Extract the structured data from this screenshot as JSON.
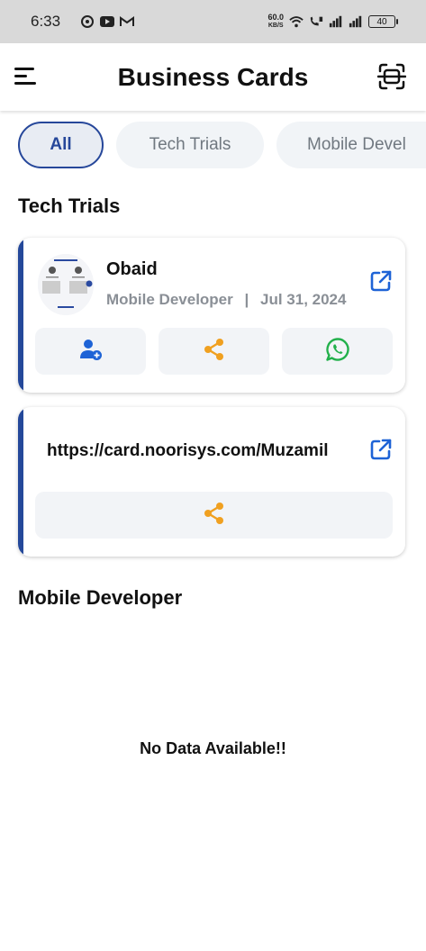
{
  "status_bar": {
    "time": "6:33",
    "net_speed_value": "60.0",
    "net_speed_unit": "KB/S",
    "battery": "40",
    "icons": [
      "record-icon",
      "youtube-icon",
      "gmail-icon",
      "wifi-icon",
      "volte-call-icon",
      "signal-icon",
      "signal-icon",
      "battery-icon"
    ]
  },
  "app_bar": {
    "title": "Business Cards",
    "left_icon": "menu-icon",
    "right_icon": "scan-card-icon"
  },
  "filters": [
    {
      "label": "All",
      "active": true
    },
    {
      "label": "Tech Trials",
      "active": false
    },
    {
      "label": "Mobile Devel",
      "active": false
    }
  ],
  "sections": [
    {
      "title": "Tech Trials",
      "cards": [
        {
          "name": "Obaid",
          "role": "Mobile Developer",
          "separator": "|",
          "date": "Jul 31, 2024",
          "open_icon": "external-link-icon",
          "actions": [
            {
              "icon": "add-contact-icon",
              "color": "#1e63d6"
            },
            {
              "icon": "share-icon",
              "color": "#f0a020"
            },
            {
              "icon": "whatsapp-icon",
              "color": "#22b04b"
            }
          ]
        },
        {
          "url": "https://card.noorisys.com/Muzamil",
          "open_icon": "external-link-icon",
          "actions": [
            {
              "icon": "share-icon",
              "color": "#f0a020"
            }
          ]
        }
      ]
    },
    {
      "title": "Mobile Developer",
      "empty_message": "No Data Available!!"
    }
  ],
  "colors": {
    "accent": "#24489a",
    "link_icon": "#1e63d6",
    "share": "#f0a020",
    "whatsapp": "#22b04b",
    "muted_text": "#8a8f96"
  }
}
